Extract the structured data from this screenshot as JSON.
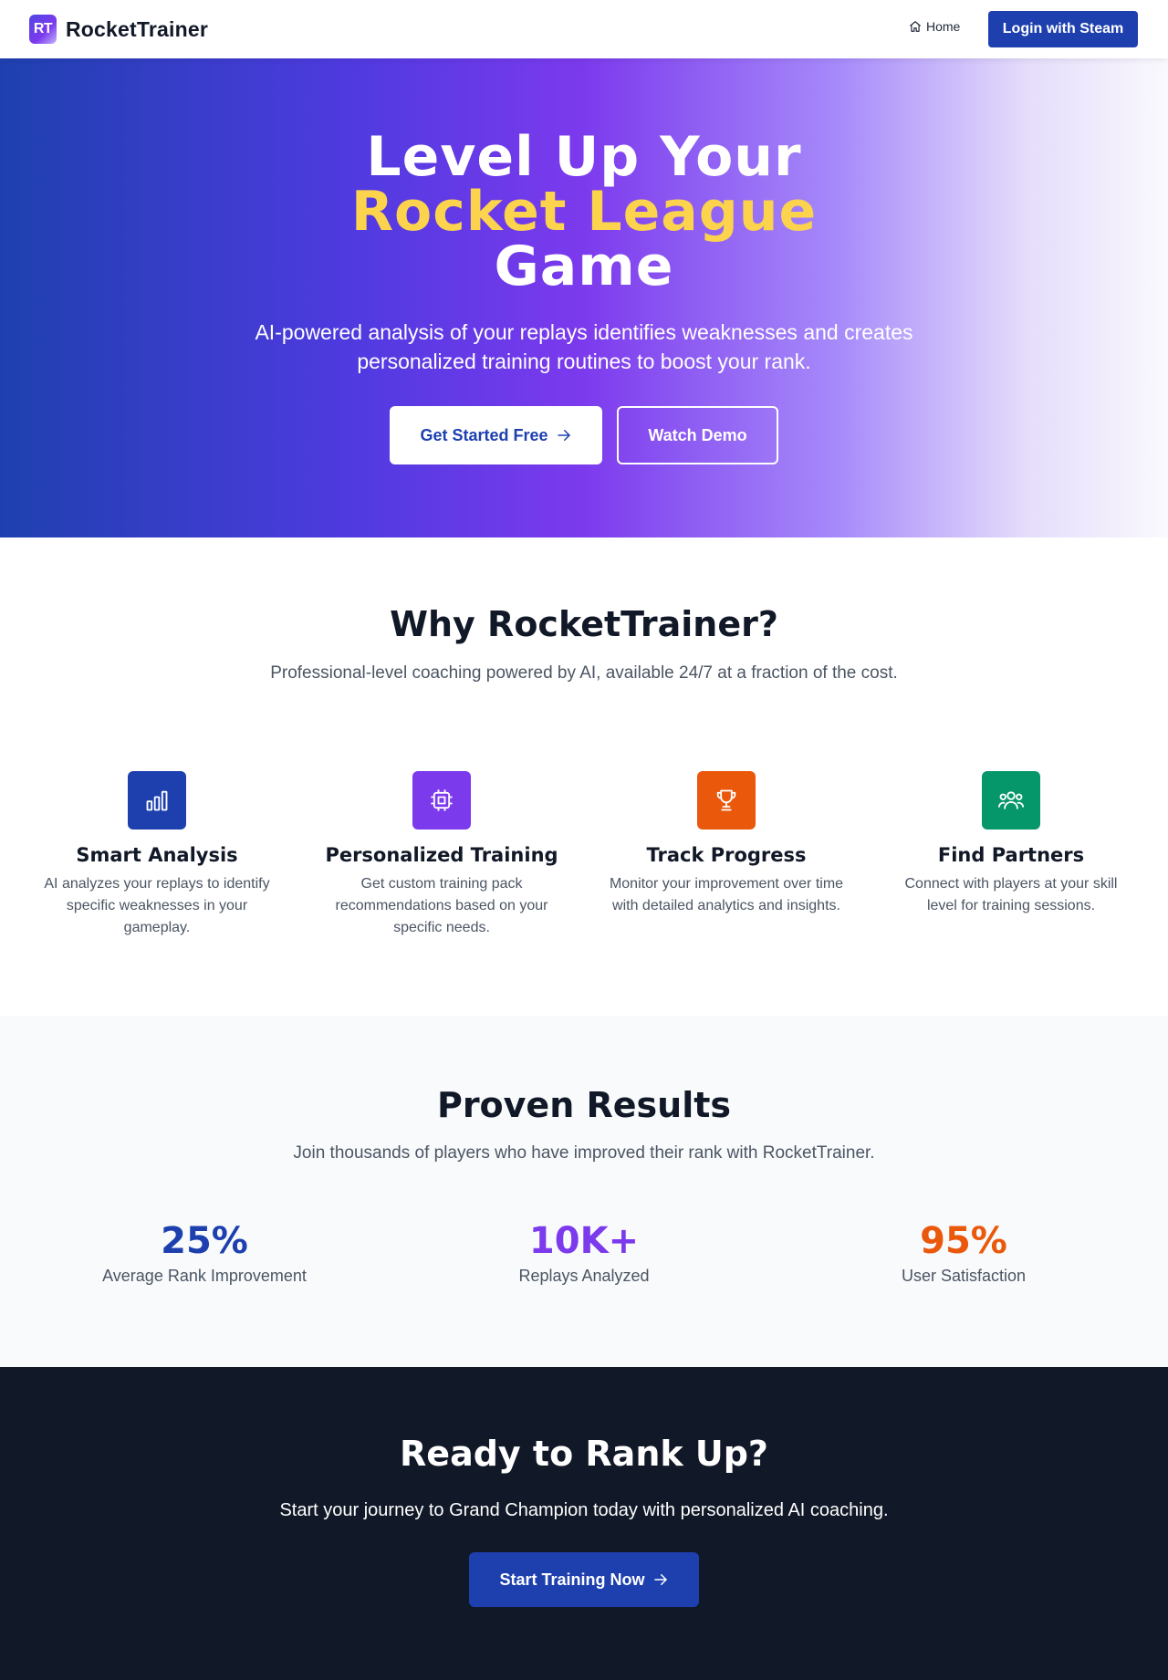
{
  "nav": {
    "logo_text": "RT",
    "brand_name": "RocketTrainer",
    "home_label": "Home",
    "login_label": "Login with Steam"
  },
  "hero": {
    "title_line1": "Level Up Your",
    "title_line2": "Rocket League",
    "title_line3": "Game",
    "subtitle": "AI-powered analysis of your replays identifies weaknesses and creates personalized training routines to boost your rank.",
    "primary_button": "Get Started Free",
    "secondary_button": "Watch Demo"
  },
  "features": {
    "title": "Why RocketTrainer?",
    "subtitle": "Professional-level coaching powered by AI, available 24/7 at a fraction of the cost.",
    "items": [
      {
        "title": "Smart Analysis",
        "description": "AI analyzes your replays to identify specific weaknesses in your gameplay.",
        "icon": "bar-chart-icon",
        "color": "#1e40af"
      },
      {
        "title": "Personalized Training",
        "description": "Get custom training pack recommendations based on your specific needs.",
        "icon": "chip-icon",
        "color": "#7c3aed"
      },
      {
        "title": "Track Progress",
        "description": "Monitor your improvement over time with detailed analytics and insights.",
        "icon": "trophy-icon",
        "color": "#ea580c"
      },
      {
        "title": "Find Partners",
        "description": "Connect with players at your skill level for training sessions.",
        "icon": "users-icon",
        "color": "#059669"
      }
    ]
  },
  "results": {
    "title": "Proven Results",
    "subtitle": "Join thousands of players who have improved their rank with RocketTrainer.",
    "stats": [
      {
        "value": "25%",
        "label": "Average Rank Improvement",
        "color": "#1e40af"
      },
      {
        "value": "10K+",
        "label": "Replays Analyzed",
        "color": "#7c3aed"
      },
      {
        "value": "95%",
        "label": "User Satisfaction",
        "color": "#ea580c"
      }
    ]
  },
  "cta": {
    "title": "Ready to Rank Up?",
    "subtitle": "Start your journey to Grand Champion today with personalized AI coaching.",
    "button": "Start Training Now"
  }
}
